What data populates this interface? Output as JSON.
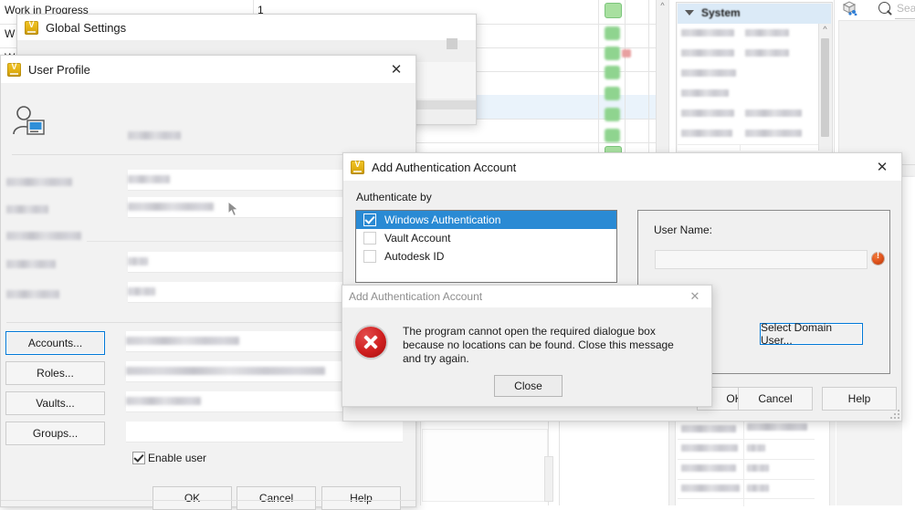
{
  "app": {
    "background": {
      "wip_label": "Work in Progress",
      "wip_count": "1",
      "panel_section_title": "System",
      "search_placeholder": "Sear",
      "search_icon": "search-icon",
      "share_icon": "share-cube-icon"
    }
  },
  "global_settings": {
    "title": "Global Settings",
    "icon": "vault-app-icon"
  },
  "user_profile": {
    "title": "User Profile",
    "icon": "vault-app-icon",
    "close_icon": "close-icon",
    "avatar_icon": "user-with-computer-icon",
    "buttons": {
      "accounts": "Accounts...",
      "roles": "Roles...",
      "vaults": "Vaults...",
      "groups": "Groups...",
      "ok": "OK",
      "cancel": "Cancel",
      "help": "Help"
    },
    "enable_user_label": "Enable user",
    "enable_user_checked": true
  },
  "add_auth_account": {
    "title": "Add Authentication Account",
    "icon": "vault-app-icon",
    "close_icon": "close-icon",
    "authenticate_by_label": "Authenticate by",
    "methods": [
      {
        "label": "Windows Authentication",
        "checked": true,
        "selected": true
      },
      {
        "label": "Vault Account",
        "checked": false,
        "selected": false
      },
      {
        "label": "Autodesk ID",
        "checked": false,
        "selected": false
      }
    ],
    "user_name_label": "User Name:",
    "user_name_value": "",
    "user_name_error_icon": "error-badge-icon",
    "select_domain_user": "Select Domain User...",
    "buttons": {
      "ok": "OK",
      "cancel": "Cancel",
      "help": "Help"
    }
  },
  "error_dialog": {
    "title": "Add Authentication Account",
    "close_icon": "close-icon",
    "error_icon": "error-cross-icon",
    "message": "The program cannot open the required dialogue box because no locations can be found. Close this message and try again.",
    "close_button": "Close"
  },
  "colors": {
    "accent_blue": "#2a8ad4",
    "focus_blue": "#0078d7",
    "error_red": "#cf1f1f",
    "warn_orange": "#e0531c",
    "vault_gold": "#e3b113",
    "panel_header_blue": "#dbeaf7",
    "status_green": "#8fd48f"
  }
}
